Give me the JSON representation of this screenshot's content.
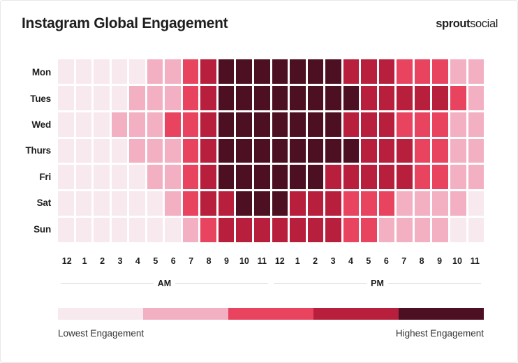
{
  "header": {
    "title": "Instagram Global Engagement",
    "brand_bold": "sprout",
    "brand_light": "social"
  },
  "legend": {
    "low_label": "Lowest Engagement",
    "high_label": "Highest Engagement",
    "colors": [
      "#f7e9ee",
      "#f2b0c2",
      "#e8435f",
      "#b71f3d",
      "#4d0f22"
    ]
  },
  "axis": {
    "periods": [
      "AM",
      "PM"
    ],
    "hours": [
      "12",
      "1",
      "2",
      "3",
      "4",
      "5",
      "6",
      "7",
      "8",
      "9",
      "10",
      "11",
      "12",
      "1",
      "2",
      "3",
      "4",
      "5",
      "6",
      "7",
      "8",
      "9",
      "10",
      "11"
    ]
  },
  "chart_data": {
    "type": "heatmap",
    "title": "Instagram Global Engagement",
    "xlabel": "",
    "ylabel": "",
    "grid": true,
    "legend_position": "bottom",
    "colorscale": [
      "#f7e9ee",
      "#f2b0c2",
      "#e8435f",
      "#b71f3d",
      "#4d0f22"
    ],
    "colorscale_labels": [
      "Lowest Engagement",
      "",
      "",
      "",
      "Highest Engagement"
    ],
    "x_categories": [
      "12 AM",
      "1 AM",
      "2 AM",
      "3 AM",
      "4 AM",
      "5 AM",
      "6 AM",
      "7 AM",
      "8 AM",
      "9 AM",
      "10 AM",
      "11 AM",
      "12 PM",
      "1 PM",
      "2 PM",
      "3 PM",
      "4 PM",
      "5 PM",
      "6 PM",
      "7 PM",
      "8 PM",
      "9 PM",
      "10 PM",
      "11 PM"
    ],
    "y_categories": [
      "Mon",
      "Tues",
      "Wed",
      "Thurs",
      "Fri",
      "Sat",
      "Sun"
    ],
    "value_scale": [
      1,
      5
    ],
    "value_note": "Engagement level bin: 1 = lowest, 5 = highest",
    "values": [
      [
        1,
        1,
        1,
        1,
        1,
        2,
        2,
        3,
        4,
        5,
        5,
        5,
        5,
        5,
        5,
        5,
        4,
        4,
        4,
        3,
        3,
        3,
        2,
        2
      ],
      [
        1,
        1,
        1,
        1,
        2,
        2,
        2,
        3,
        4,
        5,
        5,
        5,
        5,
        5,
        5,
        5,
        5,
        4,
        4,
        4,
        4,
        4,
        3,
        2
      ],
      [
        1,
        1,
        1,
        2,
        2,
        2,
        3,
        3,
        4,
        5,
        5,
        5,
        5,
        5,
        5,
        5,
        4,
        4,
        4,
        3,
        3,
        3,
        2,
        2
      ],
      [
        1,
        1,
        1,
        1,
        2,
        2,
        2,
        3,
        4,
        5,
        5,
        5,
        5,
        5,
        5,
        5,
        5,
        4,
        4,
        4,
        3,
        3,
        2,
        2
      ],
      [
        1,
        1,
        1,
        1,
        1,
        2,
        2,
        3,
        4,
        5,
        5,
        5,
        5,
        5,
        5,
        4,
        4,
        4,
        4,
        4,
        3,
        3,
        2,
        2
      ],
      [
        1,
        1,
        1,
        1,
        1,
        1,
        2,
        3,
        4,
        4,
        5,
        5,
        5,
        4,
        4,
        4,
        3,
        3,
        3,
        2,
        2,
        2,
        2,
        1
      ],
      [
        1,
        1,
        1,
        1,
        1,
        1,
        1,
        2,
        3,
        4,
        4,
        4,
        4,
        4,
        4,
        4,
        3,
        3,
        2,
        2,
        2,
        2,
        1,
        1
      ]
    ]
  }
}
